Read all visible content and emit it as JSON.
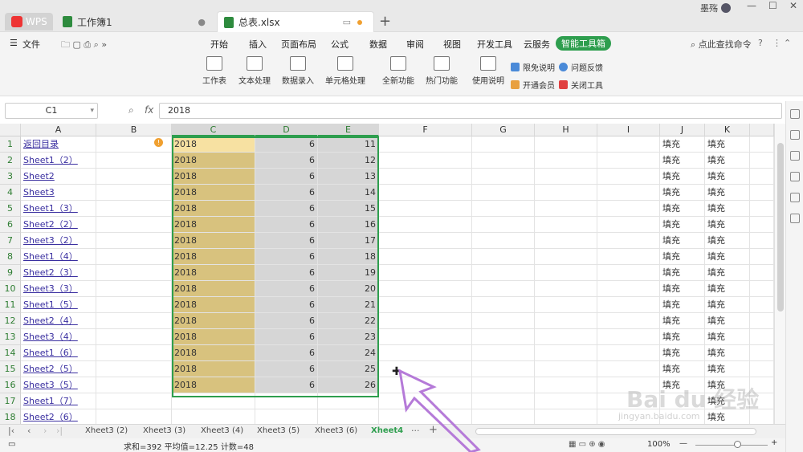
{
  "titlebar": {
    "wps_label": "WPS",
    "tab1_label": "工作簿1",
    "tab2_label": "总表.xlsx",
    "user_name": "墨殇"
  },
  "menu": [
    "开始",
    "插入",
    "页面布局",
    "公式",
    "数据",
    "审阅",
    "视图",
    "开发工具",
    "云服务",
    "智能工具箱"
  ],
  "file_menu": "文件",
  "search_cmd": "点此查找命令",
  "ribbon": {
    "buttons": [
      "工作表",
      "文本处理",
      "数据录入",
      "单元格处理",
      "全新功能",
      "热门功能",
      "使用说明"
    ],
    "small": [
      "限免说明",
      "问题反馈",
      "开通会员",
      "关闭工具"
    ]
  },
  "formula_bar": {
    "namebox": "C1",
    "fx": "fx",
    "value": "2018"
  },
  "columns": [
    "A",
    "B",
    "C",
    "D",
    "E",
    "F",
    "G",
    "H",
    "I",
    "J",
    "K"
  ],
  "rows": [
    {
      "n": "1",
      "a": "返回目录",
      "c": "2018",
      "d": "6",
      "e": "11",
      "j": "填充",
      "k": "填充"
    },
    {
      "n": "2",
      "a": "Sheet1（2）",
      "c": "2018",
      "d": "6",
      "e": "12",
      "j": "填充",
      "k": "填充"
    },
    {
      "n": "3",
      "a": "Sheet2",
      "c": "2018",
      "d": "6",
      "e": "13",
      "j": "填充",
      "k": "填充"
    },
    {
      "n": "4",
      "a": "Sheet3",
      "c": "2018",
      "d": "6",
      "e": "14",
      "j": "填充",
      "k": "填充"
    },
    {
      "n": "5",
      "a": "Sheet1（3）",
      "c": "2018",
      "d": "6",
      "e": "15",
      "j": "填充",
      "k": "填充"
    },
    {
      "n": "6",
      "a": "Sheet2（2）",
      "c": "2018",
      "d": "6",
      "e": "16",
      "j": "填充",
      "k": "填充"
    },
    {
      "n": "7",
      "a": "Sheet3（2）",
      "c": "2018",
      "d": "6",
      "e": "17",
      "j": "填充",
      "k": "填充"
    },
    {
      "n": "8",
      "a": "Sheet1（4）",
      "c": "2018",
      "d": "6",
      "e": "18",
      "j": "填充",
      "k": "填充"
    },
    {
      "n": "9",
      "a": "Sheet2（3）",
      "c": "2018",
      "d": "6",
      "e": "19",
      "j": "填充",
      "k": "填充"
    },
    {
      "n": "10",
      "a": "Sheet3（3）",
      "c": "2018",
      "d": "6",
      "e": "20",
      "j": "填充",
      "k": "填充"
    },
    {
      "n": "11",
      "a": "Sheet1（5）",
      "c": "2018",
      "d": "6",
      "e": "21",
      "j": "填充",
      "k": "填充"
    },
    {
      "n": "12",
      "a": "Sheet2（4）",
      "c": "2018",
      "d": "6",
      "e": "22",
      "j": "填充",
      "k": "填充"
    },
    {
      "n": "13",
      "a": "Sheet3（4）",
      "c": "2018",
      "d": "6",
      "e": "23",
      "j": "填充",
      "k": "填充"
    },
    {
      "n": "14",
      "a": "Sheet1（6）",
      "c": "2018",
      "d": "6",
      "e": "24",
      "j": "填充",
      "k": "填充"
    },
    {
      "n": "15",
      "a": "Sheet2（5）",
      "c": "2018",
      "d": "6",
      "e": "25",
      "j": "填充",
      "k": "填充"
    },
    {
      "n": "16",
      "a": "Sheet3（5）",
      "c": "2018",
      "d": "6",
      "e": "26",
      "j": "填充",
      "k": "填充"
    },
    {
      "n": "17",
      "a": "Sheet1（7）",
      "c": "",
      "d": "",
      "e": "",
      "j": "",
      "k": "填充"
    },
    {
      "n": "18",
      "a": "Sheet2（6）",
      "c": "",
      "d": "",
      "e": "",
      "j": "",
      "k": "填充"
    }
  ],
  "sheet_tabs": [
    "Xheet3 (2)",
    "Xheet3 (3)",
    "Xheet3 (4)",
    "Xheet3 (5)",
    "Xheet3 (6)",
    "Xheet4"
  ],
  "status": {
    "summary": "求和=392  平均值=12.25  计数=48",
    "zoom": "100%"
  },
  "watermark": {
    "text": "Bai du 经验",
    "url": "jingyan.baidu.com"
  }
}
